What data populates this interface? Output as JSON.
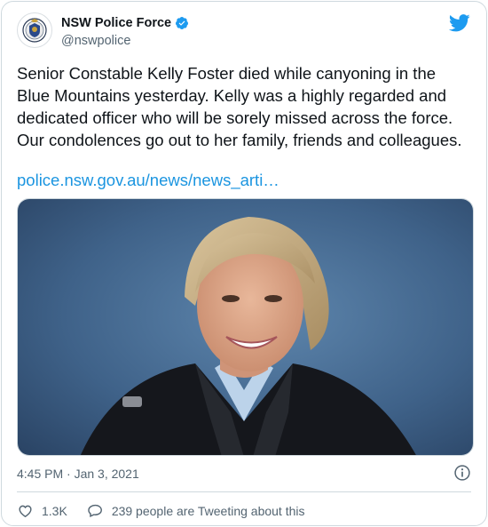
{
  "header": {
    "display_name": "NSW Police Force",
    "handle": "@nswpolice",
    "avatar_icon": "nsw-police-crest-icon",
    "verified_icon": "verified-badge-icon",
    "platform_icon": "twitter-bird-icon"
  },
  "tweet": {
    "text": "Senior Constable Kelly Foster died while canyoning in the\nBlue Mountains yesterday. Kelly was a highly regarded and\ndedicated officer who will be sorely missed across the force.\nOur condolences go out to her family, friends and colleagues.",
    "link": "police.nsw.gov.au/news/news_arti…"
  },
  "meta": {
    "timestamp": "4:45 PM · Jan 3, 2021"
  },
  "actions": {
    "likes": "1.3K",
    "replies_label": "239 people are Tweeting about this"
  },
  "colors": {
    "accent": "#1d9bf0",
    "link": "#1b95e0",
    "muted": "#536471",
    "border": "#cfd9de"
  }
}
